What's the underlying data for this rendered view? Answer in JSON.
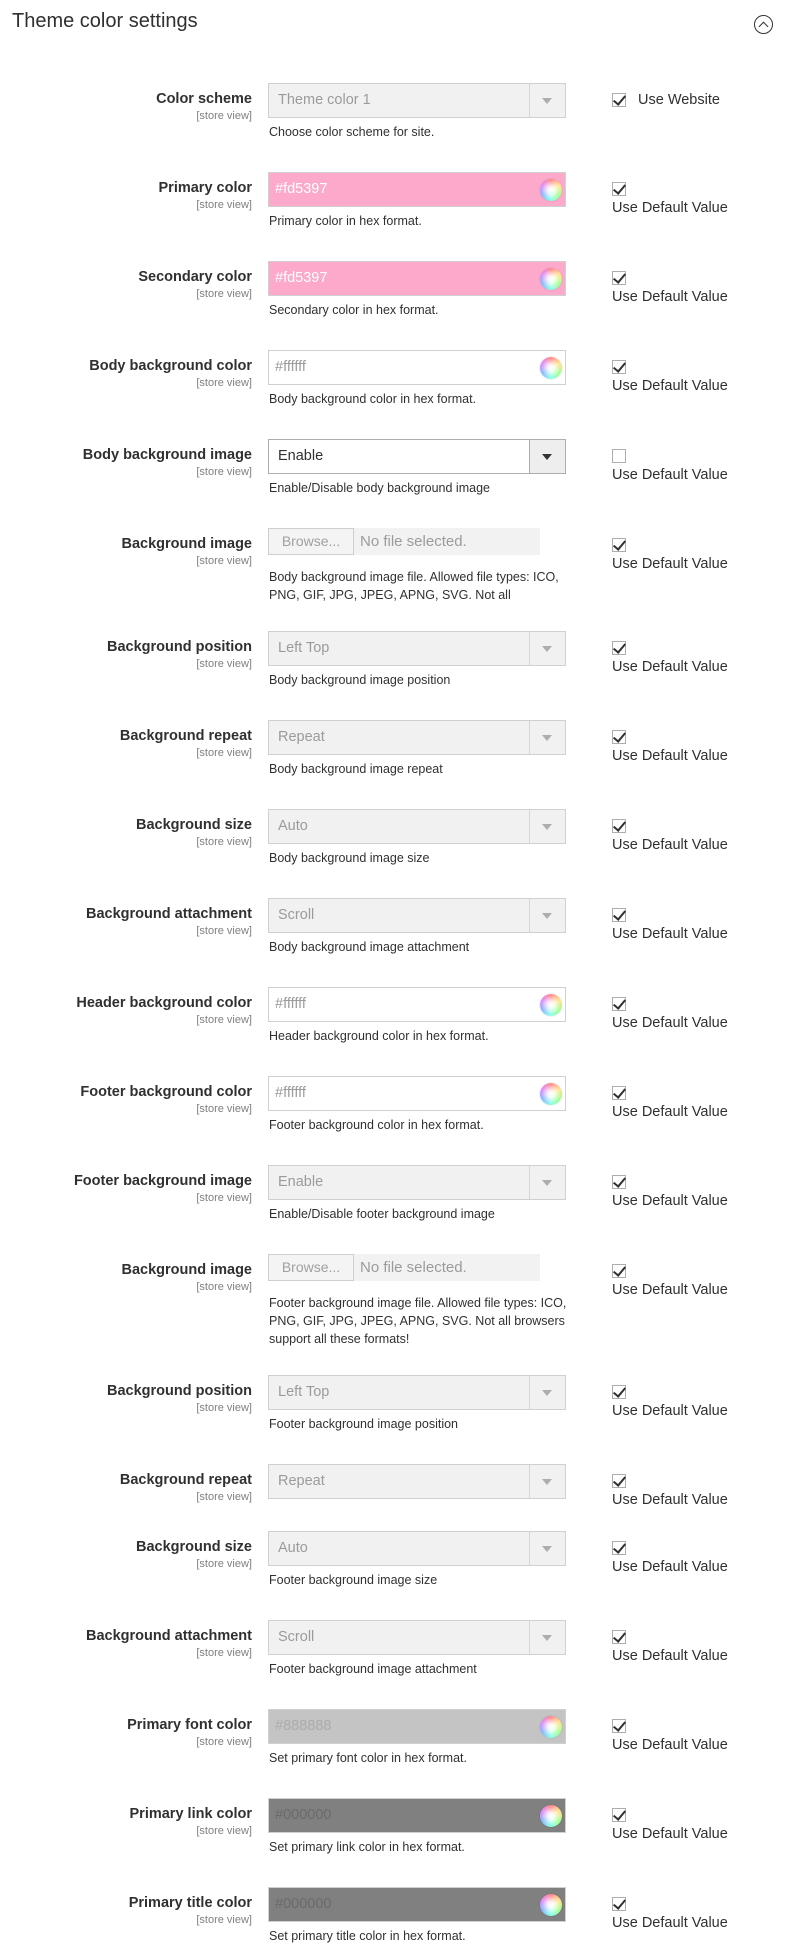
{
  "section": {
    "title": "Theme color settings"
  },
  "rows": [
    {
      "kind": "select",
      "label": "Color scheme",
      "scope": "[store view]",
      "value": "Theme color 1",
      "note": "Choose color scheme for site.",
      "active": false,
      "checked": true,
      "checkbox_label": "Use Website",
      "inline": true
    },
    {
      "kind": "color",
      "label": "Primary color",
      "scope": "[store view]",
      "value": "#fd5397",
      "bg": "#fda9cb",
      "fg": "#ffffff",
      "note": "Primary color in hex format.",
      "checked": true,
      "checkbox_label": "Use Default Value"
    },
    {
      "kind": "color",
      "label": "Secondary color",
      "scope": "[store view]",
      "value": "#fd5397",
      "bg": "#fda9cb",
      "fg": "#ffffff",
      "note": "Secondary color in hex format.",
      "checked": true,
      "checkbox_label": "Use Default Value"
    },
    {
      "kind": "color",
      "label": "Body background color",
      "scope": "[store view]",
      "value": "#ffffff",
      "bg": "#ffffff",
      "fg": "#9b9b9b",
      "note": "Body background color in hex format.",
      "checked": true,
      "checkbox_label": "Use Default Value"
    },
    {
      "kind": "select",
      "label": "Body background image",
      "scope": "[store view]",
      "value": "Enable",
      "note": "Enable/Disable body background image",
      "active": true,
      "checked": false,
      "checkbox_label": "Use Default Value"
    },
    {
      "kind": "file",
      "label": "Background image",
      "scope": "[store view]",
      "browse": "Browse...",
      "filename": "No file selected.",
      "note": "Body background image file. Allowed file types: ICO, PNG, GIF, JPG, JPEG, APNG, SVG. Not all",
      "checked": true,
      "checkbox_label": "Use Default Value"
    },
    {
      "kind": "select",
      "label": "Background position",
      "scope": "[store view]",
      "value": "Left Top",
      "note": "Body background image position",
      "active": false,
      "checked": true,
      "checkbox_label": "Use Default Value"
    },
    {
      "kind": "select",
      "label": "Background repeat",
      "scope": "[store view]",
      "value": "Repeat",
      "note": "Body background image repeat",
      "active": false,
      "checked": true,
      "checkbox_label": "Use Default Value"
    },
    {
      "kind": "select",
      "label": "Background size",
      "scope": "[store view]",
      "value": "Auto",
      "note": "Body background image size",
      "active": false,
      "checked": true,
      "checkbox_label": "Use Default Value"
    },
    {
      "kind": "select",
      "label": "Background attachment",
      "scope": "[store view]",
      "value": "Scroll",
      "note": "Body background image attachment",
      "active": false,
      "checked": true,
      "checkbox_label": "Use Default Value"
    },
    {
      "kind": "color",
      "label": "Header background color",
      "scope": "[store view]",
      "value": "#ffffff",
      "bg": "#ffffff",
      "fg": "#9b9b9b",
      "note": "Header background color in hex format.",
      "checked": true,
      "checkbox_label": "Use Default Value"
    },
    {
      "kind": "color",
      "label": "Footer background color",
      "scope": "[store view]",
      "value": "#ffffff",
      "bg": "#ffffff",
      "fg": "#9b9b9b",
      "note": "Footer background color in hex format.",
      "checked": true,
      "checkbox_label": "Use Default Value"
    },
    {
      "kind": "select",
      "label": "Footer background image",
      "scope": "[store view]",
      "value": "Enable",
      "note": "Enable/Disable footer background image",
      "active": false,
      "checked": true,
      "checkbox_label": "Use Default Value"
    },
    {
      "kind": "file",
      "label": "Background image",
      "scope": "[store view]",
      "browse": "Browse...",
      "filename": "No file selected.",
      "note": "Footer background image file. Allowed file types: ICO, PNG, GIF, JPG, JPEG, APNG, SVG. Not all browsers support all these formats!",
      "checked": true,
      "checkbox_label": "Use Default Value"
    },
    {
      "kind": "select",
      "label": "Background position",
      "scope": "[store view]",
      "value": "Left Top",
      "note": "Footer background image position",
      "active": false,
      "checked": true,
      "checkbox_label": "Use Default Value"
    },
    {
      "kind": "select",
      "label": "Background repeat",
      "scope": "[store view]",
      "value": "Repeat",
      "note": "",
      "active": false,
      "checked": true,
      "checkbox_label": "Use Default Value"
    },
    {
      "kind": "select",
      "label": "Background size",
      "scope": "[store view]",
      "value": "Auto",
      "note": "Footer background image size",
      "active": false,
      "checked": true,
      "checkbox_label": "Use Default Value"
    },
    {
      "kind": "select",
      "label": "Background attachment",
      "scope": "[store view]",
      "value": "Scroll",
      "note": "Footer background image attachment",
      "active": false,
      "checked": true,
      "checkbox_label": "Use Default Value"
    },
    {
      "kind": "color",
      "label": "Primary font color",
      "scope": "[store view]",
      "value": "#888888",
      "bg": "#c4c4c4",
      "fg": "#ababab",
      "note": "Set primary font color in hex format.",
      "checked": true,
      "checkbox_label": "Use Default Value"
    },
    {
      "kind": "color",
      "label": "Primary link color",
      "scope": "[store view]",
      "value": "#000000",
      "bg": "#808080",
      "fg": "#6a6a6a",
      "note": "Set primary link color in hex format.",
      "checked": true,
      "checkbox_label": "Use Default Value"
    },
    {
      "kind": "color",
      "label": "Primary title color",
      "scope": "[store view]",
      "value": "#000000",
      "bg": "#808080",
      "fg": "#6a6a6a",
      "note": "Set primary title color in hex format.",
      "checked": true,
      "checkbox_label": "Use Default Value"
    }
  ]
}
